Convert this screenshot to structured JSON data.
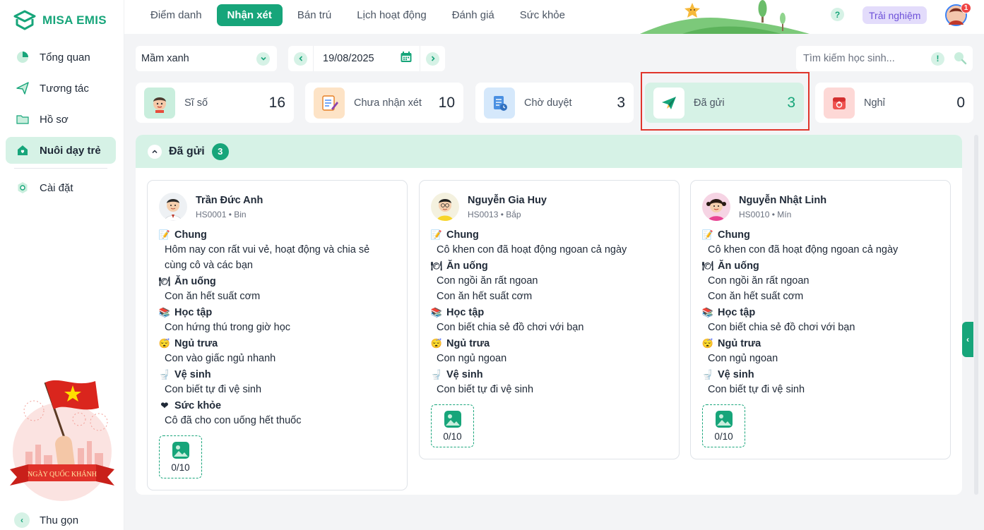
{
  "brand": {
    "name": "MISA EMIS",
    "accent": "#17a57a"
  },
  "sidebar": {
    "items": [
      {
        "label": "Tổng quan",
        "icon": "pie-chart-icon"
      },
      {
        "label": "Tương tác",
        "icon": "paper-plane-icon"
      },
      {
        "label": "Hồ sơ",
        "icon": "folder-icon"
      },
      {
        "label": "Nuôi dạy trẻ",
        "icon": "house-heart-icon",
        "active": true
      },
      {
        "label": "Cài đặt",
        "icon": "gear-icon"
      }
    ],
    "banner_text": "NGÀY QUỐC KHÁNH",
    "collapse_label": "Thu gọn"
  },
  "topbar": {
    "tabs": [
      "Điểm danh",
      "Nhận xét",
      "Bán trú",
      "Lịch hoạt động",
      "Đánh giá",
      "Sức khỏe"
    ],
    "active_tab": "Nhận xét",
    "help": "?",
    "trial_label": "Trải nghiệm",
    "notification_count": "1"
  },
  "filters": {
    "class_value": "Mầm xanh",
    "date_value": "19/08/2025",
    "search_placeholder": "Tìm kiếm học sinh...",
    "warn_icon": "!"
  },
  "stats": [
    {
      "label": "Sĩ số",
      "value": "16"
    },
    {
      "label": "Chưa nhận xét",
      "value": "10"
    },
    {
      "label": "Chờ duyệt",
      "value": "3"
    },
    {
      "label": "Đã gửi",
      "value": "3"
    },
    {
      "label": "Nghỉ",
      "value": "0"
    }
  ],
  "section": {
    "title": "Đã gửi",
    "count": "3"
  },
  "cards": [
    {
      "name": "Trần Đức Anh",
      "sub": "HS0001 • Bin",
      "groups": [
        {
          "title": "Chung",
          "lines": [
            "Hôm nay con rất vui vẻ, hoạt động và chia sẻ",
            "cùng cô và các bạn"
          ]
        },
        {
          "title": "Ăn uống",
          "lines": [
            "Con ăn hết suất cơm"
          ]
        },
        {
          "title": "Học tập",
          "lines": [
            "Con hứng thú trong giờ học"
          ]
        },
        {
          "title": "Ngủ trưa",
          "lines": [
            "Con vào giấc ngủ nhanh"
          ]
        },
        {
          "title": "Vệ sinh",
          "lines": [
            "Con biết tự đi vệ sinh"
          ]
        },
        {
          "title": "Sức khỏe",
          "lines": [
            "Cô đã cho con uống hết thuốc"
          ]
        }
      ],
      "photos": "0/10"
    },
    {
      "name": "Nguyễn Gia Huy",
      "sub": "HS0013 • Bắp",
      "groups": [
        {
          "title": "Chung",
          "lines": [
            "Cô khen con đã hoạt động ngoan cả ngày"
          ]
        },
        {
          "title": "Ăn uống",
          "lines": [
            "Con ngồi ăn rất ngoan",
            "Con ăn hết suất cơm"
          ]
        },
        {
          "title": "Học tập",
          "lines": [
            "Con biết chia sẻ đồ chơi với bạn"
          ]
        },
        {
          "title": "Ngủ trưa",
          "lines": [
            "Con ngủ ngoan"
          ]
        },
        {
          "title": "Vệ sinh",
          "lines": [
            "Con biết tự đi vệ sinh"
          ]
        }
      ],
      "photos": "0/10"
    },
    {
      "name": "Nguyễn Nhật Linh",
      "sub": "HS0010 • Mín",
      "groups": [
        {
          "title": "Chung",
          "lines": [
            "Cô khen con đã hoạt động ngoan cả ngày"
          ]
        },
        {
          "title": "Ăn uống",
          "lines": [
            "Con ngồi ăn rất ngoan",
            "Con ăn hết suất cơm"
          ]
        },
        {
          "title": "Học tập",
          "lines": [
            "Con biết chia sẻ đồ chơi với bạn"
          ]
        },
        {
          "title": "Ngủ trưa",
          "lines": [
            "Con ngủ ngoan"
          ]
        },
        {
          "title": "Vệ sinh",
          "lines": [
            "Con biết tự đi vệ sinh"
          ]
        }
      ],
      "photos": "0/10"
    }
  ]
}
